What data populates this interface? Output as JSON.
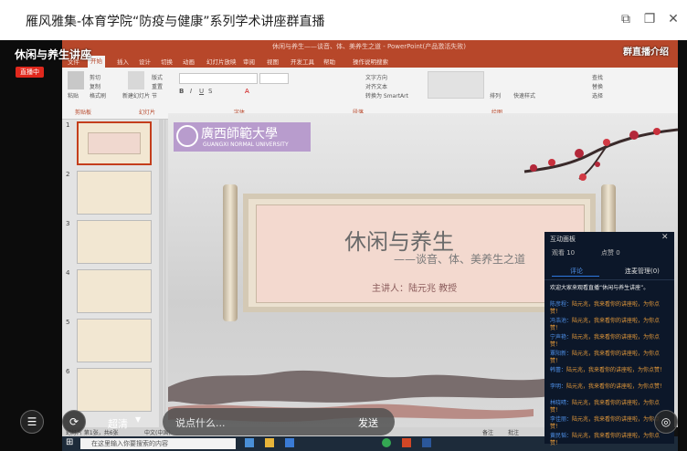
{
  "window": {
    "title": "雁风雅集-体育学院“防疫与健康”系列学术讲座群直播"
  },
  "overlay": {
    "live_title": "休闲与养生讲座",
    "live_badge": "直播中",
    "group_intro": "群直播介绍"
  },
  "powerpoint": {
    "title": "休闲与养生——谈音、体、美养生之道 - PowerPoint(产品激活失败)",
    "tabs": [
      "文件",
      "开始",
      "插入",
      "设计",
      "切换",
      "动画",
      "幻灯片放映",
      "审阅",
      "视图",
      "开发工具",
      "帮助",
      "操作说明搜索"
    ],
    "active_tab": "开始",
    "ribbon": {
      "paste": "粘贴",
      "cut": "剪切",
      "copy": "复制",
      "format_painter": "格式刷",
      "new_slide": "新建幻灯片",
      "layout": "版式",
      "reset": "重置",
      "section": "节",
      "groups": [
        "剪贴板",
        "幻灯片",
        "字体",
        "段落",
        "绘图"
      ],
      "text_direction": "文字方向",
      "align_text": "对齐文本",
      "convert_smartart": "转换为 SmartArt",
      "arrange": "排列",
      "quick_styles": "快速样式",
      "find": "查找",
      "replace": "替换",
      "select": "选择"
    },
    "thumbnails": [
      "1",
      "2",
      "3",
      "4",
      "5",
      "6"
    ]
  },
  "slide": {
    "logo_cn": "廣西師範大學",
    "logo_en": "GUANGXI NORMAL UNIVERSITY",
    "title": "休闲与养生",
    "subtitle": "——谈音、体、美养生之道",
    "presenter": "主讲人：陆元兆  教授"
  },
  "chat": {
    "header": "互动面板",
    "online": "观看 10",
    "likes": "点赞 0",
    "tab_comments": "评论",
    "tab_notice": "连麦管理(0)",
    "messages": [
      {
        "name": "",
        "text": "欢迎大家来观看直播“休闲与养生讲座”。",
        "sys": true
      },
      {
        "name": "陈彦程：",
        "text": "陆元兆，我来看你的讲座啦，为你点赞！",
        "sys": false
      },
      {
        "name": "冯浩池：",
        "text": "陆元兆，我来看你的讲座啦，为你点赞！",
        "sys": false
      },
      {
        "name": "宁声艳：",
        "text": "陆元兆，我来看你的讲座啦，为你点赞！",
        "sys": false
      },
      {
        "name": "覃阳新：",
        "text": "陆元兆，我来看你的讲座啦，为你点赞！",
        "sys": false
      },
      {
        "name": "韩蕾：",
        "text": "陆元兆，我来看你的讲座啦，为你点赞！",
        "sys": false
      },
      {
        "name": "李明：",
        "text": "陆元兆，我来看你的讲座啦，为你点赞！",
        "sys": false
      },
      {
        "name": "林晓晴：",
        "text": "陆元兆，我来看你的讲座啦，为你点赞！",
        "sys": false
      },
      {
        "name": "李佳丽：",
        "text": "陆元兆，我来看你的讲座啦，为你点赞！",
        "sys": false
      },
      {
        "name": "黄民韬：",
        "text": "陆元兆，我来看你的讲座啦，为你点赞！",
        "sys": false
      }
    ]
  },
  "controls": {
    "quality": "超清",
    "comment_placeholder": "说点什么...",
    "send": "发送"
  },
  "statusbar": {
    "slide_info": "幻灯片 第1张，共6张",
    "language": "中文(中国)",
    "notes": "备注",
    "zoom": "批注"
  },
  "taskbar": {
    "search_placeholder": "在这里输入你要搜索的内容"
  }
}
